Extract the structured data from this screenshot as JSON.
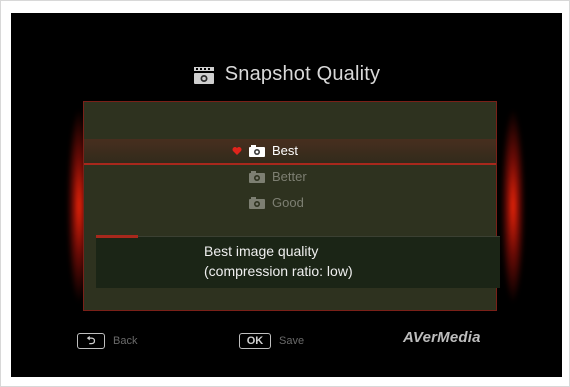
{
  "title": "Snapshot Quality",
  "title_icon": "film-camera-icon",
  "options": [
    {
      "label": "Best",
      "selected": true,
      "icon": "camera-icon"
    },
    {
      "label": "Better",
      "selected": false,
      "icon": "camera-icon"
    },
    {
      "label": "Good",
      "selected": false,
      "icon": "camera-icon"
    }
  ],
  "description": {
    "line1": "Best image quality",
    "line2": "(compression ratio: low)"
  },
  "footer": {
    "back_key": "⮌",
    "back_label": "Back",
    "ok_key": "OK",
    "save_label": "Save",
    "brand": "AVerMedia"
  },
  "colors": {
    "accent": "#a8281c",
    "panel": "#2e321f",
    "glow": "#ff280a"
  }
}
